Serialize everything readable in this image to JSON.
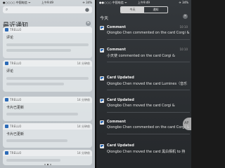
{
  "left": {
    "status": {
      "carrier": "●○○○○ 中国电信 ᯤ",
      "time": "上午9:49",
      "battery": "✈ 34%"
    },
    "section_title": "最近通知",
    "notifications": [
      {
        "app": "TRELLO",
        "time": "",
        "text": "评论"
      },
      {
        "app": "TRELLO",
        "time": "14 分钟前",
        "text": "评论"
      },
      {
        "app": "TRELLO",
        "time": "14 分钟前",
        "text": "卡片已更新"
      },
      {
        "app": "TRELLO",
        "time": "14 分钟前",
        "text": "卡片已更新"
      },
      {
        "app": "TRELLO",
        "time": "14 分钟前",
        "text": ""
      }
    ]
  },
  "right": {
    "status": {
      "carrier": "●●○○○ 中国电信 ᯤ",
      "time": "上午9:49",
      "battery": "✈ 34%"
    },
    "tabs": [
      "今天",
      "通知"
    ],
    "today": "今天",
    "notifications": [
      {
        "title": "Comment",
        "time": "10:10",
        "body": "Qiongbo Chen commented on the card Corgi &"
      },
      {
        "title": "Comment",
        "time": "10:10",
        "body": "小天使 commented on the card Corgi &"
      },
      {
        "title": "Card Updated",
        "time": "",
        "body": "Qiongbo Chen moved the card Lumines（音乐"
      },
      {
        "title": "Card Updated",
        "time": "",
        "body": "Qiongbo Chen moved the card Corgi &"
      },
      {
        "title": "Comment",
        "time": "",
        "body": "Qiongbo Chen commented on the card Corgi &"
      },
      {
        "title": "Card Updated",
        "time": "",
        "body": "Qiongbo Chen moved the card 黑白相机 to 持"
      }
    ],
    "assist_label": "AP"
  }
}
